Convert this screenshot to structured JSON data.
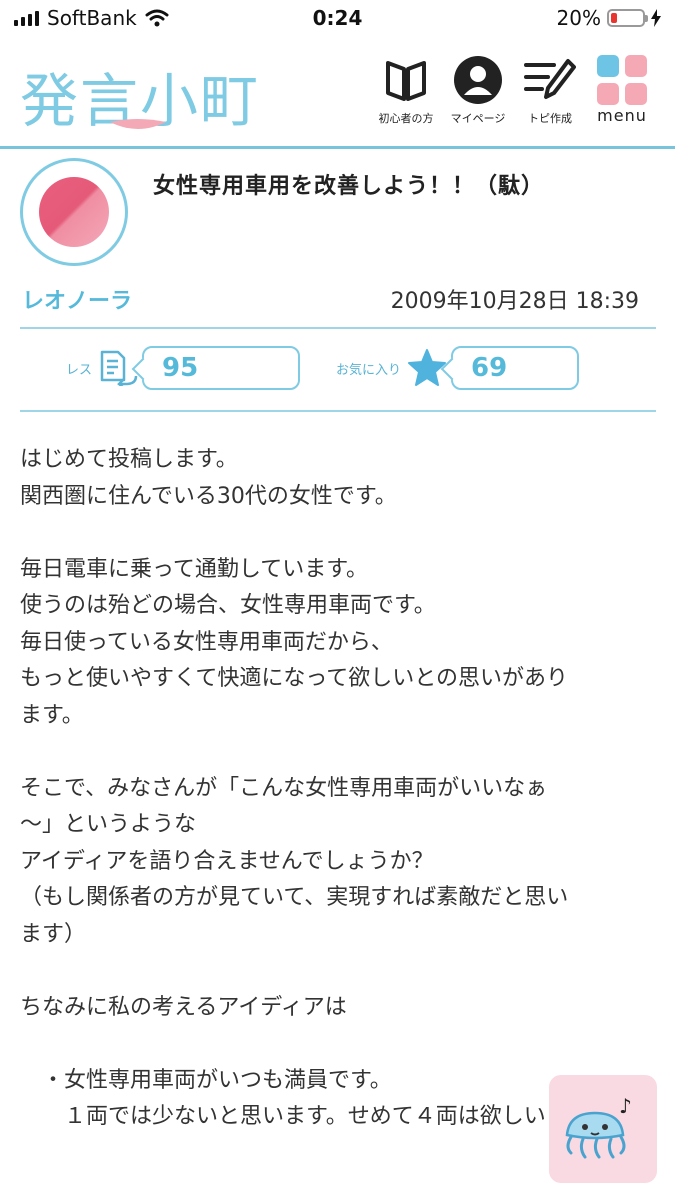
{
  "status_bar": {
    "carrier": "SoftBank",
    "time": "0:24",
    "battery_percent": "20%",
    "battery_level": 0.2
  },
  "header": {
    "logo_text": "発言小町",
    "nav": [
      {
        "label": "初心者の方",
        "icon": "book-icon"
      },
      {
        "label": "マイページ",
        "icon": "person-icon"
      },
      {
        "label": "トピ作成",
        "icon": "pencil-note-icon"
      },
      {
        "label": "menu",
        "icon": "menu-grid-icon"
      }
    ]
  },
  "post": {
    "title": "女性専用車用を改善しよう！！（駄）",
    "author": "レオノーラ",
    "date": "2009年10月28日 18:39",
    "res_label": "レス",
    "res_count": "95",
    "fav_label": "お気に入り",
    "fav_count": "69",
    "body": [
      "はじめて投稿します。",
      "関西圏に住んでいる30代の女性です。",
      "",
      "毎日電車に乗って通勤しています。",
      "使うのは殆どの場合、女性専用車両です。",
      "毎日使っている女性専用車両だから、",
      "もっと使いやすくて快適になって欲しいとの思いがあり",
      "ます。",
      "",
      "そこで、みなさんが「こんな女性専用車両がいいなぁ",
      "～」というような",
      "アイディアを語り合えませんでしょうか？",
      "（もし関係者の方が見ていて、実現すれば素敵だと思い",
      "ます）",
      "",
      "ちなみに私の考えるアイディアは",
      "",
      "　・女性専用車両がいつも満員です。",
      "　　１両では少ないと思います。せめて４両は欲しい"
    ]
  },
  "colors": {
    "accent": "#7fcbe3",
    "accent_text": "#55b9da",
    "menu_blue": "#6ec4e4",
    "menu_pink": "#f4a9b5",
    "avatar_pink": "#e95f7e"
  }
}
